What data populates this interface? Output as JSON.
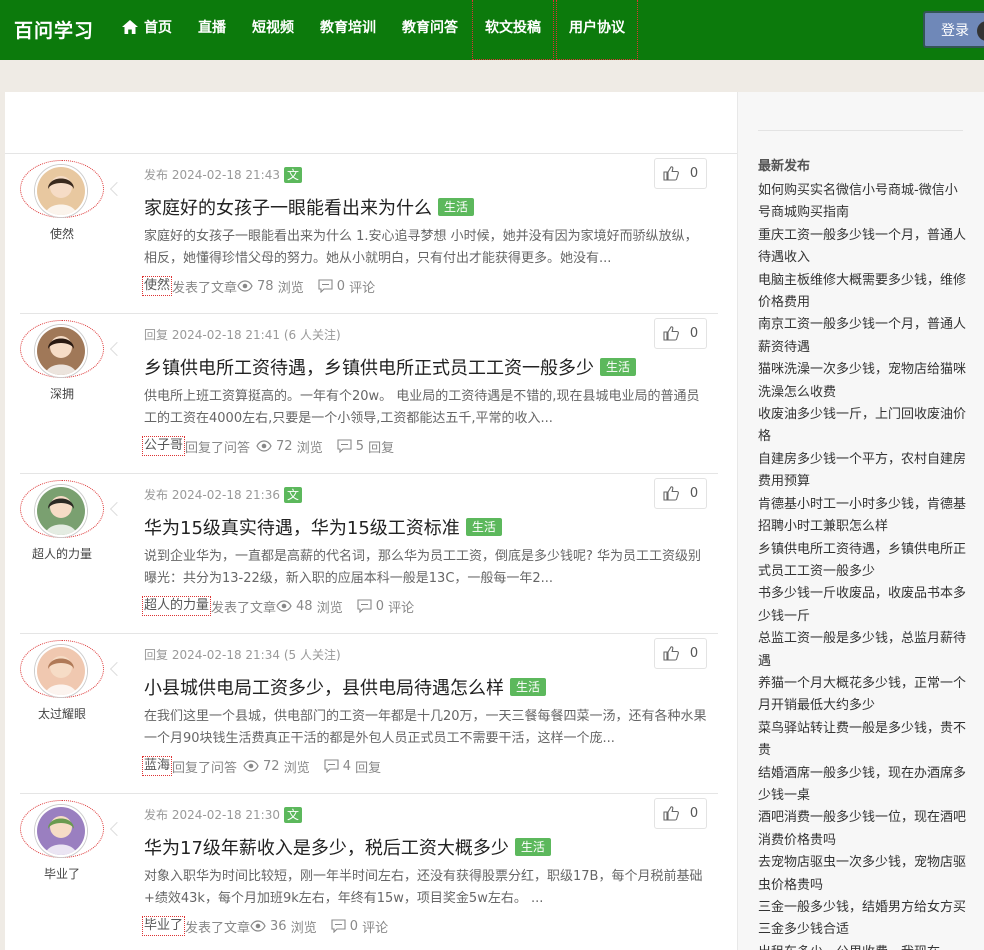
{
  "site": {
    "logo": "百问学习"
  },
  "nav": {
    "items": [
      {
        "label": "首页",
        "icon": "home-icon"
      },
      {
        "label": "直播"
      },
      {
        "label": "短视频"
      },
      {
        "label": "教育培训"
      },
      {
        "label": "教育问答"
      },
      {
        "label": "软文投稿"
      },
      {
        "label": "用户协议"
      }
    ],
    "login_label": "登录"
  },
  "sidebar": {
    "title": "最新发布",
    "links": [
      "如何购买实名微信小号商城-微信小号商城购买指南",
      "重庆工资一般多少钱一个月，普通人待遇收入",
      "电脑主板维修大概需要多少钱，维修价格费用",
      "南京工资一般多少钱一个月，普通人薪资待遇",
      "猫咪洗澡一次多少钱，宠物店给猫咪洗澡怎么收费",
      "收废油多少钱一斤，上门回收废油价格",
      "自建房多少钱一个平方，农村自建房费用预算",
      "肯德基小时工一小时多少钱，肯德基招聘小时工兼职怎么样",
      "乡镇供电所工资待遇，乡镇供电所正式员工工资一般多少",
      "书多少钱一斤收废品，收废品书本多少钱一斤",
      "总监工资一般是多少钱，总监月薪待遇",
      "养猫一个月大概花多少钱，正常一个月开销最低大约多少",
      "菜鸟驿站转让费一般是多少钱，贵不贵",
      "结婚酒席一般多少钱，现在办酒席多少钱一桌",
      "酒吧消费一般多少钱一位，现在酒吧消费价格贵吗",
      "去宠物店驱虫一次多少钱，宠物店驱虫价格贵吗",
      "三金一般多少钱，结婚男方给女方买三金多少钱合适",
      "出租车多少一公里收费，我现在"
    ]
  },
  "feed": [
    {
      "user": "使然",
      "action": "发布",
      "time": "2024-02-18 21:43",
      "followers": "",
      "badge": "文",
      "likes": "0",
      "title": "家庭好的女孩子一眼能看出来为什么",
      "tag": "生活",
      "excerpt": "家庭好的女孩子一眼能看出来为什么 1.安心追寻梦想 小时候，她并没有因为家境好而骄纵放纵，相反，她懂得珍惜父母的努力。她从小就明白，只有付出才能获得更多。她没有...",
      "author_link": "使然",
      "verb": "发表了文章",
      "views": "78",
      "views_label": "浏览",
      "replies": "0",
      "replies_label": "评论",
      "avatar_color": "#e8c8a0",
      "avatar_hair": "#3a2a1e"
    },
    {
      "user": "深拥",
      "action": "回复",
      "time": "2024-02-18 21:41",
      "followers": "(6 人关注)",
      "badge": "",
      "likes": "0",
      "title": "乡镇供电所工资待遇，乡镇供电所正式员工工资一般多少",
      "tag": "生活",
      "excerpt": "供电所上班工资算挺高的。一年有个20w。 电业局的工资待遇是不错的,现在县城电业局的普通员工的工资在4000左右,只要是一个小领导,工资都能达五千,平常的收入...",
      "author_link": "公子哥",
      "verb": "回复了问答",
      "views": "72",
      "views_label": "浏览",
      "replies": "5",
      "replies_label": "回复",
      "avatar_color": "#a07858",
      "avatar_hair": "#2a1a12"
    },
    {
      "user": "超人的力量",
      "action": "发布",
      "time": "2024-02-18 21:36",
      "followers": "",
      "badge": "文",
      "likes": "0",
      "title": "华为15级真实待遇，华为15级工资标准",
      "tag": "生活",
      "excerpt": "说到企业华为，一直都是高薪的代名词，那么华为员工工资，倒底是多少钱呢? 华为员工工资级别曝光：共分为13-22级，新入职的应届本科一般是13C，一般每一年2...",
      "author_link": "超人的力量",
      "verb": "发表了文章",
      "views": "48",
      "views_label": "浏览",
      "replies": "0",
      "replies_label": "评论",
      "avatar_color": "#7aa070",
      "avatar_hair": "#2c2a24"
    },
    {
      "user": "太过耀眼",
      "action": "回复",
      "time": "2024-02-18 21:34",
      "followers": "(5 人关注)",
      "badge": "",
      "likes": "0",
      "title": "小县城供电局工资多少，县供电局待遇怎么样",
      "tag": "生活",
      "excerpt": "在我们这里一个县城，供电部门的工资一年都是十几20万，一天三餐每餐四菜一汤，还有各种水果一个月90块钱生活费真正干活的都是外包人员正式员工不需要干活，这样一个庞...",
      "author_link": "蓝海",
      "verb": "回复了问答",
      "views": "72",
      "views_label": "浏览",
      "replies": "4",
      "replies_label": "回复",
      "avatar_color": "#f0c8b0",
      "avatar_hair": "#b07a58"
    },
    {
      "user": "毕业了",
      "action": "发布",
      "time": "2024-02-18 21:30",
      "followers": "",
      "badge": "文",
      "likes": "0",
      "title": "华为17级年薪收入是多少，税后工资大概多少",
      "tag": "生活",
      "excerpt": "对象入职华为时间比较短，刚一年半时间左右，还没有获得股票分红，职级17B，每个月税前基础+绩效43k，每个月加班9k左右，年终有15w，项目奖金5w左右。 ...",
      "author_link": "毕业了",
      "verb": "发表了文章",
      "views": "36",
      "views_label": "浏览",
      "replies": "0",
      "replies_label": "评论",
      "avatar_color": "#9a7fc0",
      "avatar_hair": "#6a9a50"
    }
  ]
}
